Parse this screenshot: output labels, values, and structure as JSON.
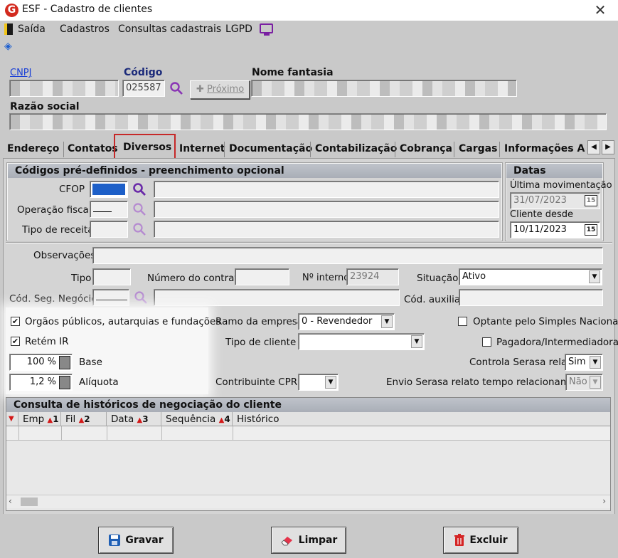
{
  "window": {
    "title": "ESF - Cadastro de clientes",
    "close_glyph": "✕",
    "logo_letter": "G",
    "accent": "#d32a1e"
  },
  "menu": {
    "items": [
      "Saída",
      "Cadastros",
      "Consultas cadastrais",
      "LGPD"
    ]
  },
  "header_fields": {
    "cnpj_label": "CNPJ",
    "codigo_label": "Código",
    "codigo_value": "025587",
    "proximo_label": "Próximo",
    "nome_fantasia_label": "Nome fantasia",
    "razao_social_label": "Razão social"
  },
  "tabs": [
    "Endereço",
    "Contatos",
    "Diversos",
    "Internet",
    "Documentação",
    "Contabilização",
    "Cobrança",
    "Cargas",
    "Informações Adi"
  ],
  "active_tab": "Diversos",
  "codigos": {
    "header": "Códigos pré-definidos - preenchimento opcional",
    "cfop_label": "CFOP",
    "operacao_label": "Operação fiscal",
    "receita_label": "Tipo de receita"
  },
  "datas": {
    "header": "Datas",
    "ultima_label": "Última movimentação",
    "ultima_value": "31/07/2023",
    "cliente_desde_label": "Cliente desde",
    "cliente_desde_value": "10/11/2023",
    "cal_glyph": "15"
  },
  "mid": {
    "observacoes_label": "Observações",
    "tipo_label": "Tipo",
    "numero_contrato_label": "Número do contrato",
    "interno_label": "Nº interno",
    "interno_value": "23924",
    "situacao_label": "Situação",
    "situacao_value": "Ativo",
    "cod_seg_label": "Cód. Seg. Negócio",
    "cod_aux_label": "Cód. auxiliar"
  },
  "options": {
    "orgaos_label": "Orgãos públicos, autarquias e fundações",
    "orgaos_checked": true,
    "retem_label": "Retém IR",
    "retem_checked": true,
    "base_value": "100 %",
    "base_label": "Base",
    "aliquota_value": "1,2 %",
    "aliquota_label": "Alíquota",
    "ramo_label": "Ramo da empresa",
    "ramo_value": "0 - Revendedor",
    "tipo_cliente_label": "Tipo de cliente",
    "cprb_label": "Contribuinte CPRB",
    "optante_label": "Optante pelo Simples Nacional",
    "pagadora_label": "Pagadora/Intermediadora",
    "serasa_label": "Controla Serasa relato",
    "serasa_value": "Sim",
    "envio_label": "Envio Serasa relato tempo relacionamento",
    "envio_value": "Não"
  },
  "historico": {
    "header": "Consulta de históricos de negociação do cliente",
    "columns": [
      {
        "label": "Emp",
        "sort": "1"
      },
      {
        "label": "Fil",
        "sort": "2"
      },
      {
        "label": "Data",
        "sort": "3"
      },
      {
        "label": "Sequência",
        "sort": "4"
      },
      {
        "label": "Histórico",
        "sort": ""
      }
    ]
  },
  "buttons": {
    "gravar": "Gravar",
    "limpar": "Limpar",
    "excluir": "Excluir"
  },
  "colors": {
    "accent_blue": "#1a3fd6",
    "highlight_red": "#c62828",
    "purple_icon": "#7a1fa2",
    "cfop_fill": "#1d5fc8"
  }
}
